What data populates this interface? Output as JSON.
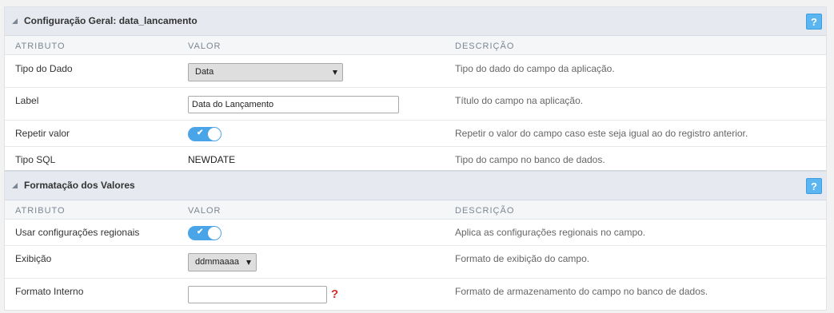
{
  "sections": [
    {
      "title": "Configuração Geral: data_lancamento",
      "help": "?",
      "headers": {
        "attr": "ATRIBUTO",
        "value": "VALOR",
        "desc": "DESCRIÇÃO"
      },
      "rows": [
        {
          "label": "Tipo do Dado",
          "select_value": "Data",
          "description": "Tipo do dado do campo da aplicação."
        },
        {
          "label": "Label",
          "input_value": "Data do Lançamento",
          "description": "Título do campo na aplicação."
        },
        {
          "label": "Repetir valor",
          "toggle_on": true,
          "toggle_mark": "✔",
          "description": "Repetir o valor do campo caso este seja igual ao do registro anterior."
        },
        {
          "label": "Tipo SQL",
          "text_value": "NEWDATE",
          "description": "Tipo do campo no banco de dados."
        }
      ]
    },
    {
      "title": "Formatação dos Valores",
      "help": "?",
      "headers": {
        "attr": "ATRIBUTO",
        "value": "VALOR",
        "desc": "DESCRIÇÃO"
      },
      "rows": [
        {
          "label": "Usar configurações regionais",
          "toggle_on": true,
          "toggle_mark": "✔",
          "description": "Aplica as configurações regionais no campo."
        },
        {
          "label": "Exibição",
          "select_value": "ddmmaaaa",
          "description": "Formato de exibição do campo."
        },
        {
          "label": "Formato Interno",
          "input_value": "",
          "hint": "?",
          "description": "Formato de armazenamento do campo no banco de dados."
        }
      ]
    }
  ]
}
